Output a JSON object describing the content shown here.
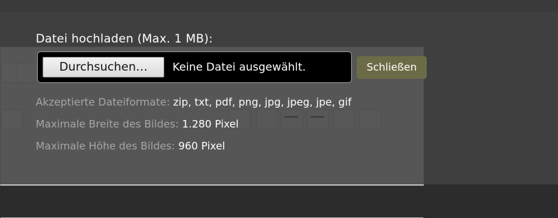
{
  "dialog": {
    "title": "Datei hochladen (Max. 1 MB):",
    "file_input": {
      "browse_label": "Durchsuchen…",
      "status_text": "Keine Datei ausgewählt."
    },
    "close_label": "Schließen",
    "info": [
      {
        "label": "Akzeptierte Dateiformate:",
        "value": "zip, txt, pdf, png, jpg, jpeg, jpe, gif"
      },
      {
        "label": "Maximale Breite des Bildes:",
        "value": "1.280 Pixel"
      },
      {
        "label": "Maximale Höhe des Bildes:",
        "value": "960 Pixel"
      }
    ]
  },
  "colors": {
    "overlay": "#404040",
    "close_button": "#6b6b47",
    "label_gray": "#a6a6a6"
  }
}
